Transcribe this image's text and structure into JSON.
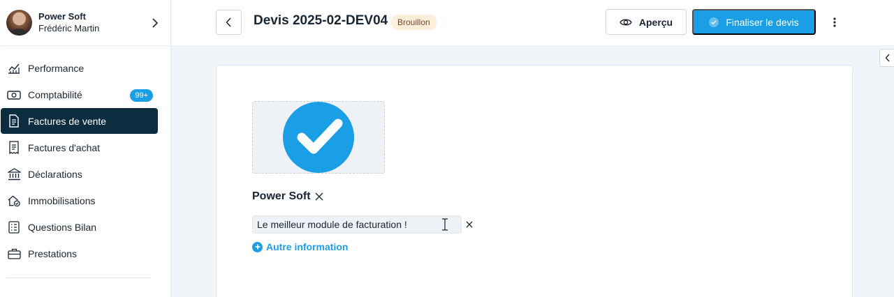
{
  "account": {
    "company": "Power Soft",
    "user": "Frédéric Martin"
  },
  "sidebar": {
    "items": [
      {
        "label": "Performance",
        "icon": "chart-line-icon"
      },
      {
        "label": "Comptabilité",
        "icon": "banknote-icon",
        "badge": "99+"
      },
      {
        "label": "Factures de vente",
        "icon": "document-icon",
        "active": true
      },
      {
        "label": "Factures d'achat",
        "icon": "receipt-icon"
      },
      {
        "label": "Déclarations",
        "icon": "bank-icon"
      },
      {
        "label": "Immobilisations",
        "icon": "house-check-icon"
      },
      {
        "label": "Questions Bilan",
        "icon": "checklist-icon"
      },
      {
        "label": "Prestations",
        "icon": "briefcase-icon"
      }
    ]
  },
  "header": {
    "title": "Devis 2025-02-DEV04",
    "status": "Brouillon",
    "preview_label": "Aperçu",
    "finalize_label": "Finaliser le devis"
  },
  "document": {
    "company_name": "Power Soft",
    "info_value": "Le meilleur module de facturation !",
    "add_info_label": "Autre information"
  },
  "colors": {
    "accent": "#1a9ee6",
    "sidebar_active": "#0c2d3f",
    "status_badge_bg": "#fdeedc"
  }
}
